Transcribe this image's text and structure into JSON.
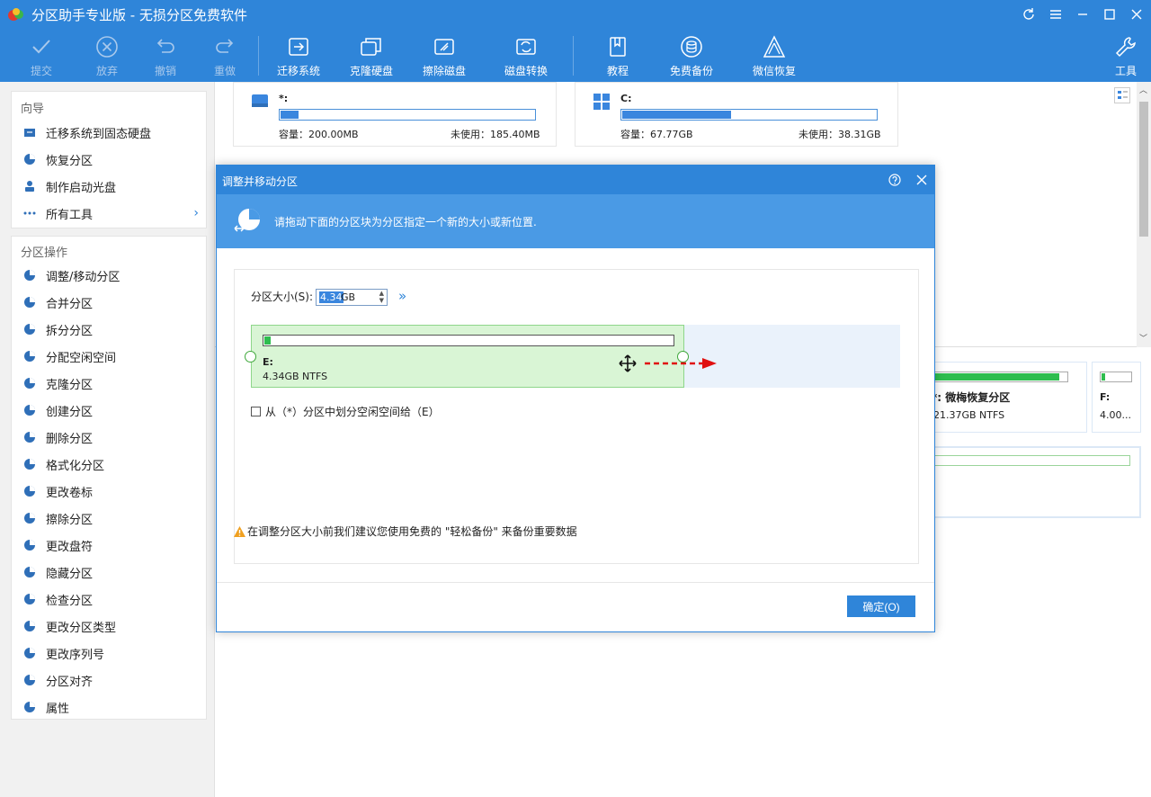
{
  "app": {
    "title": "分区助手专业版 - 无损分区免费软件"
  },
  "toolbar": {
    "commit": "提交",
    "discard": "放弃",
    "undo": "撤销",
    "redo": "重做",
    "migrate": "迁移系统",
    "clone_disk": "克隆硬盘",
    "wipe_disk": "擦除磁盘",
    "disk_convert": "磁盘转换",
    "tutorial": "教程",
    "free_backup": "免费备份",
    "wechat_recovery": "微信恢复",
    "tools": "工具"
  },
  "sidebar": {
    "wizard_title": "向导",
    "wizard_items": [
      {
        "label": "迁移系统到固态硬盘"
      },
      {
        "label": "恢复分区"
      },
      {
        "label": "制作启动光盘"
      },
      {
        "label": "所有工具"
      }
    ],
    "ops_title": "分区操作",
    "ops_items": [
      {
        "label": "调整/移动分区"
      },
      {
        "label": "合并分区"
      },
      {
        "label": "拆分分区"
      },
      {
        "label": "分配空闲空间"
      },
      {
        "label": "克隆分区"
      },
      {
        "label": "创建分区"
      },
      {
        "label": "删除分区"
      },
      {
        "label": "格式化分区"
      },
      {
        "label": "更改卷标"
      },
      {
        "label": "擦除分区"
      },
      {
        "label": "更改盘符"
      },
      {
        "label": "隐藏分区"
      },
      {
        "label": "检查分区"
      },
      {
        "label": "更改分区类型"
      },
      {
        "label": "更改序列号"
      },
      {
        "label": "分区对齐"
      },
      {
        "label": "属性"
      }
    ]
  },
  "disks": {
    "star": {
      "name": "*:",
      "capacity": "容量：200.00MB",
      "unused": "未使用：185.40MB",
      "used_fraction": 0.07
    },
    "c": {
      "name": "C:",
      "capacity": "容量：67.77GB",
      "unused": "未使用：38.31GB",
      "used_fraction": 0.43
    }
  },
  "partitions_bg": {
    "p1_name": "*: 微梅恢复分区",
    "p1_info": "21.37GB NTFS",
    "p2_name": "F:",
    "p2_info": "4.00..."
  },
  "dialog": {
    "title": "调整并移动分区",
    "banner_text": "请拖动下面的分区块为分区指定一个新的大小或新位置.",
    "size_label": "分区大小(S):",
    "size_value": "4.34",
    "size_unit": "GB",
    "partition_name": "E:",
    "partition_info": "4.34GB NTFS",
    "partition_used_fraction": 0.015,
    "checkbox_label": "从（*）分区中划分空闲空间给（E）",
    "warning_text": "在调整分区大小前我们建议您使用免费的 \"轻松备份\" 来备份重要数据",
    "ok_label": "确定(O)"
  },
  "colors": {
    "brand": "#2f85d9",
    "partition_green": "#d9f5d5",
    "arrow_red": "#e01010"
  }
}
